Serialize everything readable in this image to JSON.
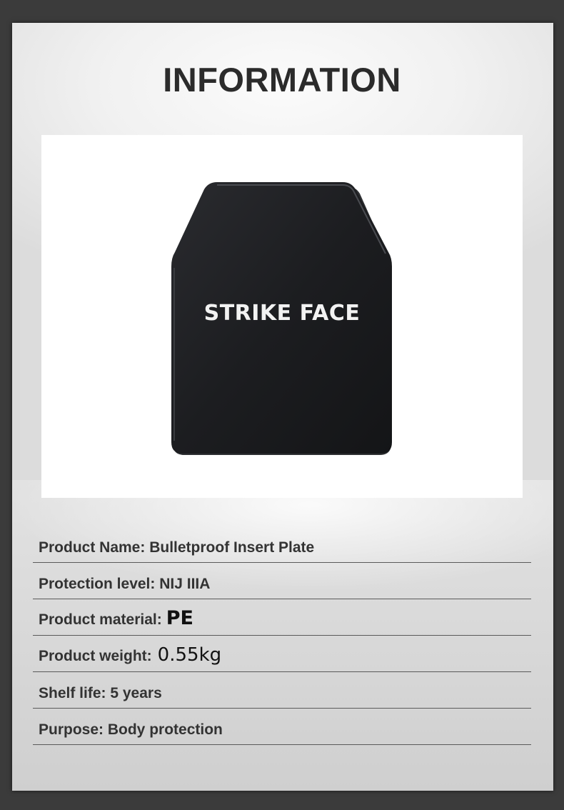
{
  "title": "INFORMATION",
  "photo": {
    "subject": "body-armor-plate",
    "plate_label": "STRIKE FACE",
    "plate_color": "#1c1d20"
  },
  "specs": [
    {
      "label": "Product Name:",
      "value": "Bulletproof Insert Plate"
    },
    {
      "label": "Protection level:",
      "value": "NIJ IIIA"
    },
    {
      "label": "Product material:",
      "value": "PE"
    },
    {
      "label": "Product weight:",
      "value": "0.55kg"
    },
    {
      "label": "Shelf life:",
      "value": "5 years"
    },
    {
      "label": "Purpose:",
      "value": "Body protection"
    }
  ],
  "colors": {
    "page_background": "#3b3b3b",
    "card_background": "#e9e9e9",
    "text": "#333333",
    "divider": "#5a5a5a"
  }
}
